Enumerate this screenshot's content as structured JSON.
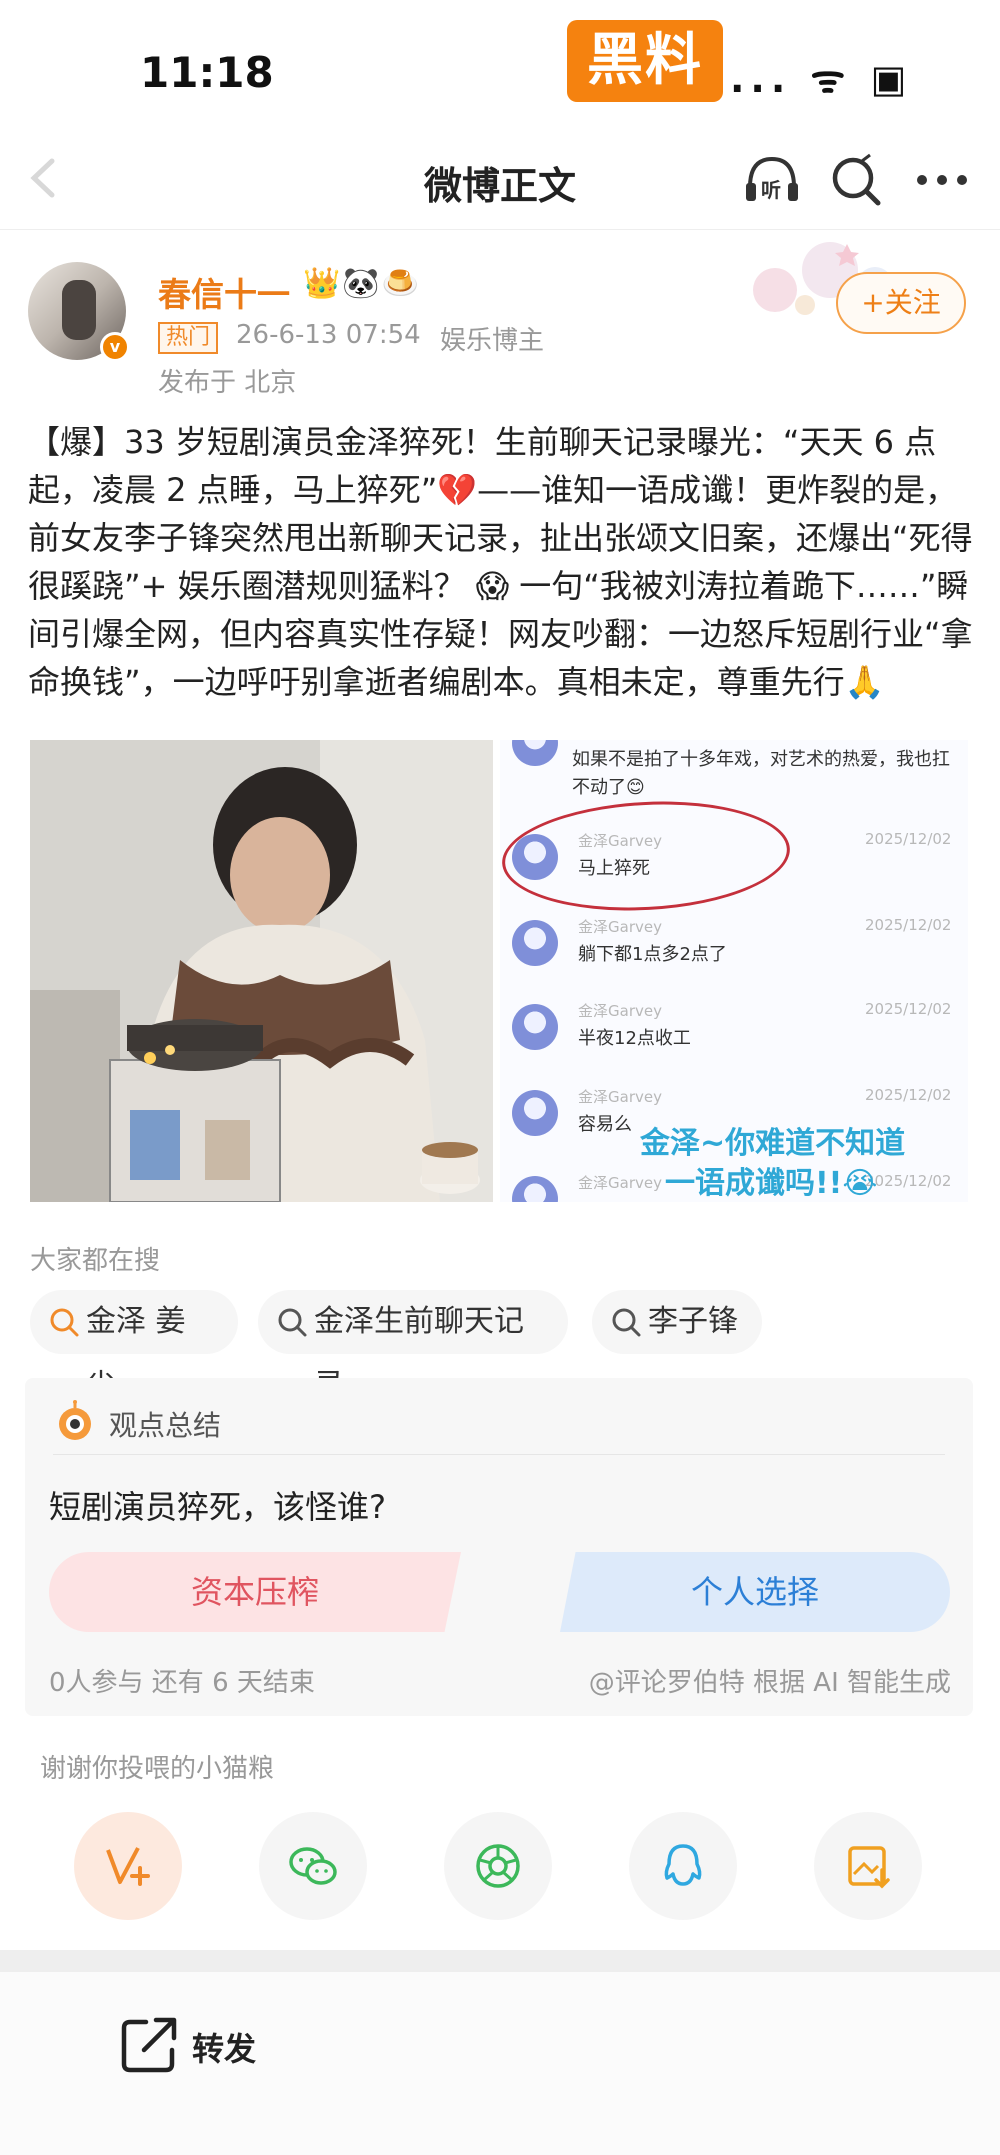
{
  "status_bar": {
    "time": "11:18",
    "badge": "黑料",
    "indicators": "... ᯤ ▣"
  },
  "nav": {
    "title": "微博正文"
  },
  "author": {
    "name": "春信十一",
    "emojis": "👑🐼🍮",
    "hot_tag": "热门",
    "timestamp": "26-6-13 07:54",
    "role": "娱乐博主",
    "location": "发布于 北京",
    "follow_label": "+关注"
  },
  "post": {
    "text": "【爆】33 岁短剧演员金泽猝死！生前聊天记录曝光：“天天 6 点起，凌晨 2 点睡，马上猝死”💔——谁知一语成谶！更炸裂的是，前女友李子锋突然甩出新聊天记录，扯出张颂文旧案，还爆出“死得很蹊跷”+ 娱乐圈潜规则猛料？ 😱 一句“我被刘涛拉着跪下……”瞬间引爆全网，但内容真实性存疑！网友吵翻：一边怒斥短剧行业“拿命换钱”，一边呼吁别拿逝者编剧本。真相未定，尊重先行🙏"
  },
  "chat_image": {
    "top_message": "如果不是拍了十多年戏，对艺术的热爱，我也扛不动了😊",
    "messages": [
      {
        "name": "金泽Garvey",
        "date": "2025/12/02",
        "text": "马上猝死"
      },
      {
        "name": "金泽Garvey",
        "date": "2025/12/02",
        "text": "躺下都1点多2点了"
      },
      {
        "name": "金泽Garvey",
        "date": "2025/12/02",
        "text": "半夜12点收工"
      },
      {
        "name": "金泽Garvey",
        "date": "2025/12/02",
        "text": "容易么"
      },
      {
        "name": "金泽Garvey",
        "date": "2025/12/02",
        "text": ""
      }
    ],
    "overlay_line1": "金泽~你难道不知道",
    "overlay_line2": "一语成谶吗!!😭"
  },
  "search": {
    "heading": "大家都在搜",
    "chips": [
      "金泽 姜尘",
      "金泽生前聊天记录",
      "李子锋"
    ]
  },
  "opinion": {
    "title": "观点总结",
    "question": "短剧演员猝死，该怪谁?",
    "choice_a": "资本压榨",
    "choice_b": "个人选择",
    "participants": "0人参与  还有 6 天结束",
    "source": "@评论罗伯特 根据 AI 智能生成"
  },
  "share": {
    "thanks": "谢谢你投喂的小猫粮",
    "icons": [
      "edit-weibo-icon",
      "wechat-icon",
      "moments-icon",
      "qq-icon",
      "save-image-icon"
    ]
  },
  "bottom": {
    "forward_label": "转发"
  },
  "colors": {
    "accent_orange": "#f5820f",
    "username_orange": "#eb7b17",
    "choice_red": "#e05560",
    "choice_blue": "#2c7fd6",
    "overlay_blue": "#2fa8d6"
  }
}
